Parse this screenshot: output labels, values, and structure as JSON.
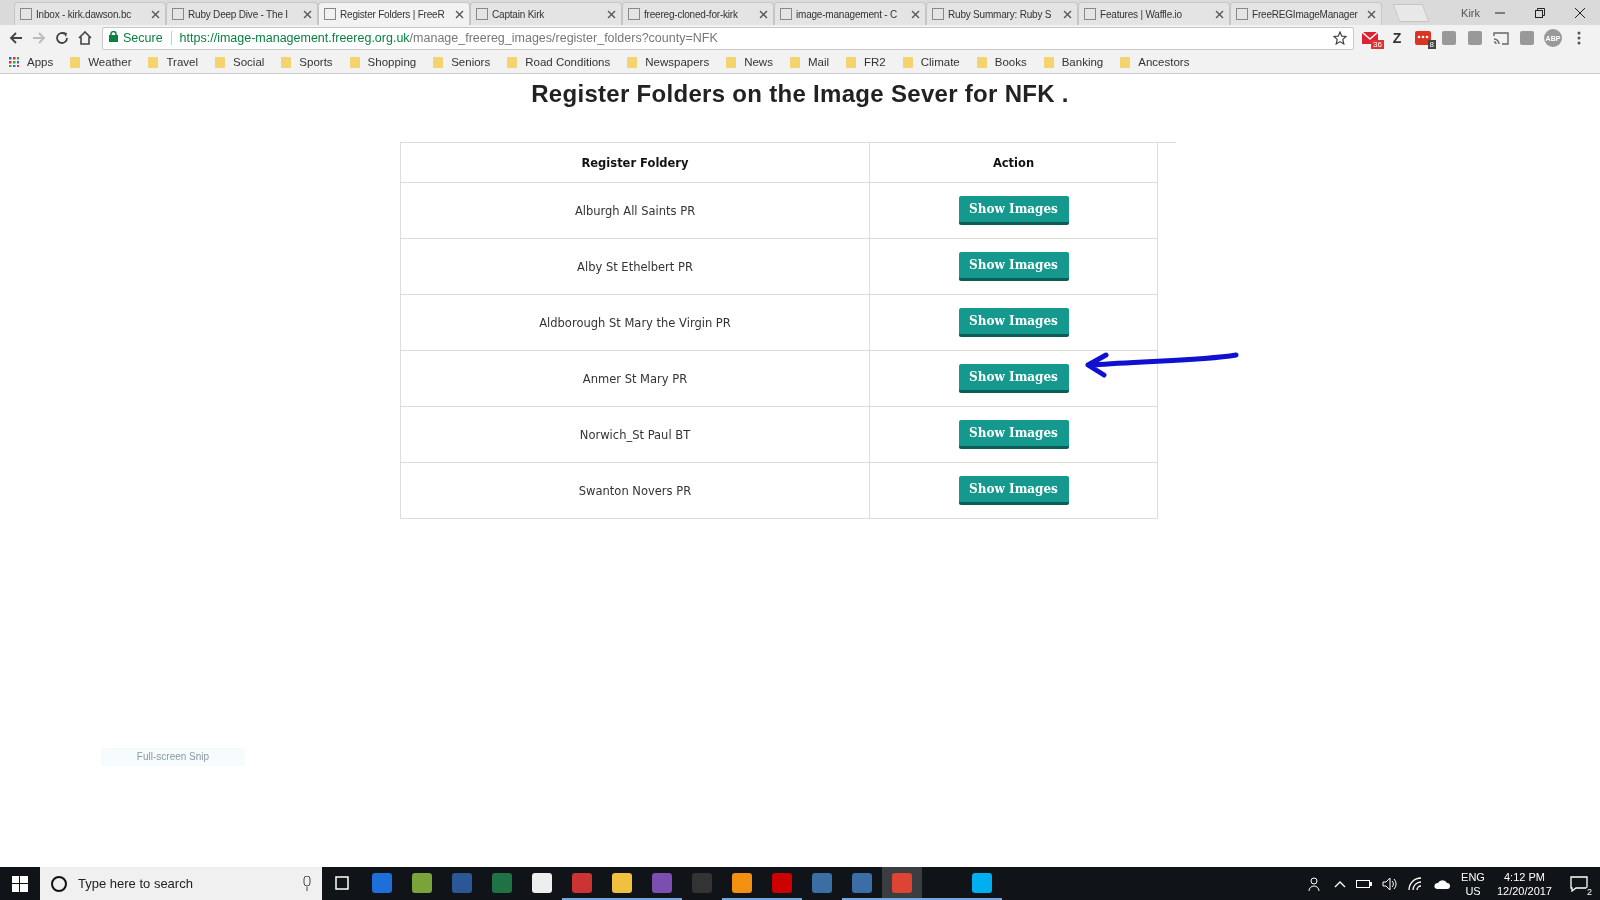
{
  "browser": {
    "tabs": [
      {
        "title": "Inbox - kirk.dawson.bc",
        "selected": false
      },
      {
        "title": "Ruby Deep Dive - The I",
        "selected": false
      },
      {
        "title": "Register Folders | FreeR",
        "selected": true
      },
      {
        "title": "Captain Kirk",
        "selected": false
      },
      {
        "title": "freereg-cloned-for-kirk",
        "selected": false
      },
      {
        "title": "image-management - C",
        "selected": false
      },
      {
        "title": "Ruby Summary: Ruby S",
        "selected": false
      },
      {
        "title": "Features | Waffle.io",
        "selected": false
      },
      {
        "title": "FreeREGImageManager",
        "selected": false
      }
    ],
    "profile": "Kirk",
    "secure_label": "Secure",
    "url_host": "https://image-management.freereg.org.uk",
    "url_path": "/manage_freereg_images/register_folders?county=NFK",
    "extensions": [
      {
        "kind": "mail",
        "badge": "36"
      },
      {
        "kind": "letter",
        "label": "Z"
      },
      {
        "kind": "dots",
        "badge": "8"
      },
      {
        "kind": "square"
      },
      {
        "kind": "square"
      },
      {
        "kind": "cast"
      },
      {
        "kind": "square"
      },
      {
        "kind": "round",
        "label": "ABP"
      }
    ],
    "apps_label": "Apps",
    "bookmarks": [
      "Weather",
      "Travel",
      "Social",
      "Sports",
      "Shopping",
      "Seniors",
      "Road Conditions",
      "Newspapers",
      "News",
      "Mail",
      "FR2",
      "Climate",
      "Books",
      "Banking",
      "Ancestors"
    ]
  },
  "page": {
    "title": "Register Folders on the Image Sever for NFK .",
    "columns": [
      "Register Foldery",
      "Action"
    ],
    "rows": [
      {
        "folder": "Alburgh All Saints PR",
        "button": "Show Images"
      },
      {
        "folder": "Alby St Ethelbert PR",
        "button": "Show Images"
      },
      {
        "folder": "Aldborough St Mary the Virgin PR",
        "button": "Show Images"
      },
      {
        "folder": "Anmer St Mary PR",
        "button": "Show Images"
      },
      {
        "folder": "Norwich_St Paul BT",
        "button": "Show Images"
      },
      {
        "folder": "Swanton Novers PR",
        "button": "Show Images"
      }
    ],
    "snip_label": "Full-screen Snip"
  },
  "taskbar": {
    "search_placeholder": "Type here to search",
    "apps": [
      {
        "active": false,
        "focused": false
      },
      {
        "active": false,
        "focused": false
      },
      {
        "active": false,
        "focused": false
      },
      {
        "active": false,
        "focused": false
      },
      {
        "active": false,
        "focused": false
      },
      {
        "active": true,
        "focused": false
      },
      {
        "active": true,
        "focused": false
      },
      {
        "active": true,
        "focused": false
      },
      {
        "active": false,
        "focused": false
      },
      {
        "active": true,
        "focused": false
      },
      {
        "active": true,
        "focused": false
      },
      {
        "active": false,
        "focused": false
      },
      {
        "active": true,
        "focused": false
      },
      {
        "active": true,
        "focused": true
      },
      {
        "active": true,
        "focused": false
      },
      {
        "active": true,
        "focused": false
      }
    ],
    "language": "ENG",
    "region": "US",
    "time": "4:12 PM",
    "date": "12/20/2017",
    "notifications": "2"
  }
}
